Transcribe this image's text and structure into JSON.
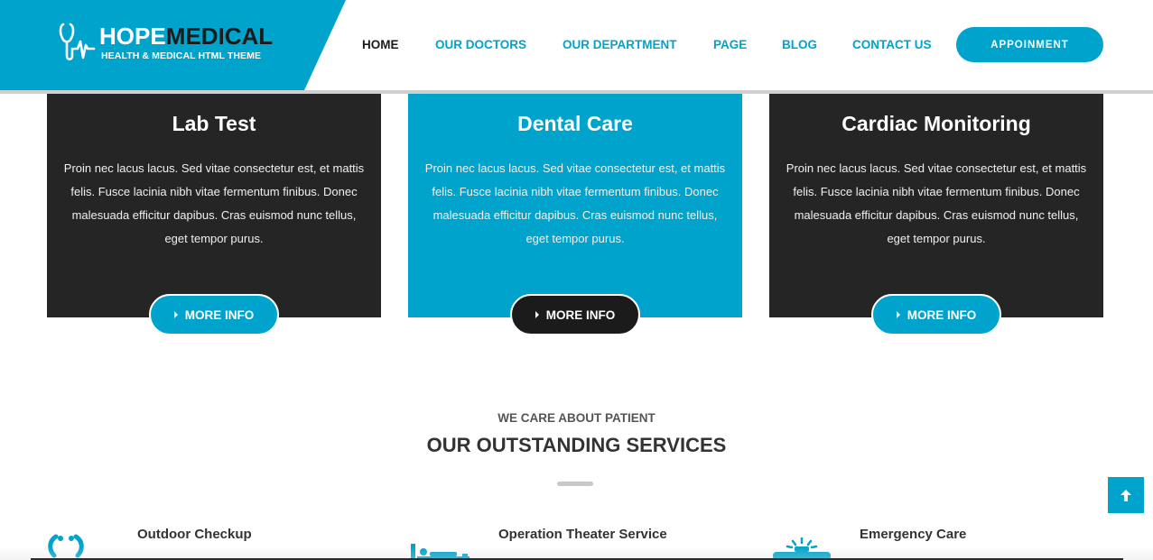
{
  "brand": {
    "title_part1": "HOPE",
    "title_part2": "MEDICAL",
    "subtitle": "HEALTH & MEDICAL HTML THEME",
    "icon": "stethoscope-icon"
  },
  "nav": {
    "items": [
      {
        "label": "HOME",
        "active": true
      },
      {
        "label": "OUR DOCTORS",
        "active": false
      },
      {
        "label": "OUR DEPARTMENT",
        "active": false
      },
      {
        "label": "PAGE",
        "active": false
      },
      {
        "label": "BLOG",
        "active": false
      },
      {
        "label": "CONTACT US",
        "active": false
      }
    ],
    "appointment_label": "APPOINMENT"
  },
  "cards": [
    {
      "title": "Lab Test",
      "text": "Proin nec lacus lacus. Sed vitae consectetur est, et mattis felis. Fusce lacinia nibh vitae fermentum finibus. Donec malesuada efficitur dapibus. Cras euismod nunc tellus, eget tempor purus.",
      "button": "MORE INFO"
    },
    {
      "title": "Dental Care",
      "text": "Proin nec lacus lacus. Sed vitae consectetur est, et mattis felis. Fusce lacinia nibh vitae fermentum finibus. Donec malesuada efficitur dapibus. Cras euismod nunc tellus, eget tempor purus.",
      "button": "MORE INFO"
    },
    {
      "title": "Cardiac Monitoring",
      "text": "Proin nec lacus lacus. Sed vitae consectetur est, et mattis felis. Fusce lacinia nibh vitae fermentum finibus. Donec malesuada efficitur dapibus. Cras euismod nunc tellus, eget tempor purus.",
      "button": "MORE INFO"
    }
  ],
  "section": {
    "subtitle": "WE CARE ABOUT PATIENT",
    "title": "OUR OUTSTANDING SERVICES"
  },
  "services": [
    {
      "title": "Outdoor Checkup",
      "icon": "checkup-icon"
    },
    {
      "title": "Operation Theater Service",
      "icon": "operation-bed-icon"
    },
    {
      "title": "Emergency Care",
      "icon": "ambulance-siren-icon"
    }
  ],
  "scroll_top_icon": "arrow-up-icon",
  "colors": {
    "accent": "#00a3cc",
    "dark": "#252525",
    "text": "#333333"
  }
}
